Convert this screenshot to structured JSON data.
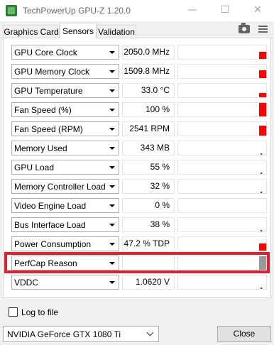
{
  "window": {
    "title": "TechPowerUp GPU-Z 1.20.0",
    "minimize": "—",
    "maximize": "☐",
    "close": "✕"
  },
  "tabs": [
    {
      "label": "Graphics Card",
      "active": false
    },
    {
      "label": "Sensors",
      "active": true
    },
    {
      "label": "Validation",
      "active": false
    }
  ],
  "sensors": [
    {
      "label": "GPU Core Clock",
      "value": "2050.0 MHz",
      "graph_level": 0.55
    },
    {
      "label": "GPU Memory Clock",
      "value": "1509.8 MHz",
      "graph_level": 0.6
    },
    {
      "label": "GPU Temperature",
      "value": "33.0 °C",
      "graph_level": 0.3
    },
    {
      "label": "Fan Speed (%)",
      "value": "100 %",
      "graph_level": 1.0
    },
    {
      "label": "Fan Speed (RPM)",
      "value": "2541 RPM",
      "graph_level": 0.75
    },
    {
      "label": "Memory Used",
      "value": "343 MB",
      "graph_level": 0.08
    },
    {
      "label": "GPU Load",
      "value": "55 %",
      "graph_level": 0.1
    },
    {
      "label": "Memory Controller Load",
      "value": "32 %",
      "graph_level": 0.08
    },
    {
      "label": "Video Engine Load",
      "value": "0 %",
      "graph_level": 0.0
    },
    {
      "label": "Bus Interface Load",
      "value": "38 %",
      "graph_level": 0.1
    },
    {
      "label": "Power Consumption",
      "value": "47.2 % TDP",
      "graph_level": 0.5
    },
    {
      "label": "PerfCap Reason",
      "value": "",
      "graph_level": 1.0,
      "graph_color": "#999999"
    },
    {
      "label": "VDDC",
      "value": "1.0620 V",
      "graph_level": 0.1
    }
  ],
  "colors": {
    "graph_bar": "#ff0000",
    "highlight": "#e0202c"
  },
  "footer": {
    "log_label": "Log to file",
    "log_checked": false,
    "gpu_selected": "NVIDIA GeForce GTX 1080 Ti",
    "close_label": "Close"
  },
  "icons": {
    "camera": "camera-icon",
    "menu": "hamburger-menu-icon"
  }
}
